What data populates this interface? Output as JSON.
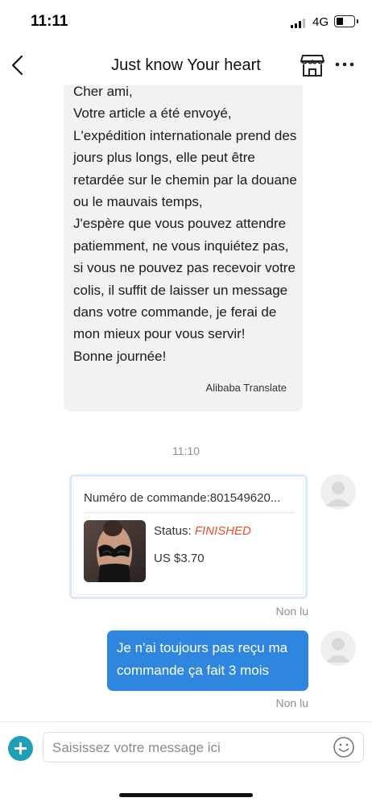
{
  "status_bar": {
    "time": "11:11",
    "network": "4G"
  },
  "header": {
    "title": "Just know Your heart",
    "back_icon": "chevron-left-icon",
    "store_icon": "store-icon",
    "more_icon": "more-dots-icon"
  },
  "messages": {
    "incoming": {
      "text": "Cher ami,\nVotre article a été envoyé,\nL'expédition internationale prend des jours plus longs, elle peut être retardée sur le chemin par la douane ou le mauvais temps,\nJ'espère que vous pouvez attendre patiemment, ne vous inquiétez pas, si vous ne pouvez pas recevoir votre colis, il suffit de laisser un message dans votre commande, je ferai de mon mieux pour vous servir!\nBonne journée!",
      "translator": "Alibaba Translate"
    },
    "timestamp": "11:10",
    "order": {
      "number": "Numéro de commande:801549620...",
      "status_label": "Status: ",
      "status_value": "FINISHED",
      "price": "US $3.70"
    },
    "order_read_status": "Non lu",
    "outgoing": {
      "text": "Je n'ai toujours pas reçu ma commande ça fait 3 mois",
      "read_status": "Non lu"
    }
  },
  "composer": {
    "placeholder": "Saisissez votre message ici",
    "add_icon": "plus-icon",
    "emoji_icon": "smiley-icon"
  },
  "colors": {
    "accent_blue": "#2e86de",
    "status_finished": "#ef4b2b",
    "add_button": "#1e9fb6"
  }
}
